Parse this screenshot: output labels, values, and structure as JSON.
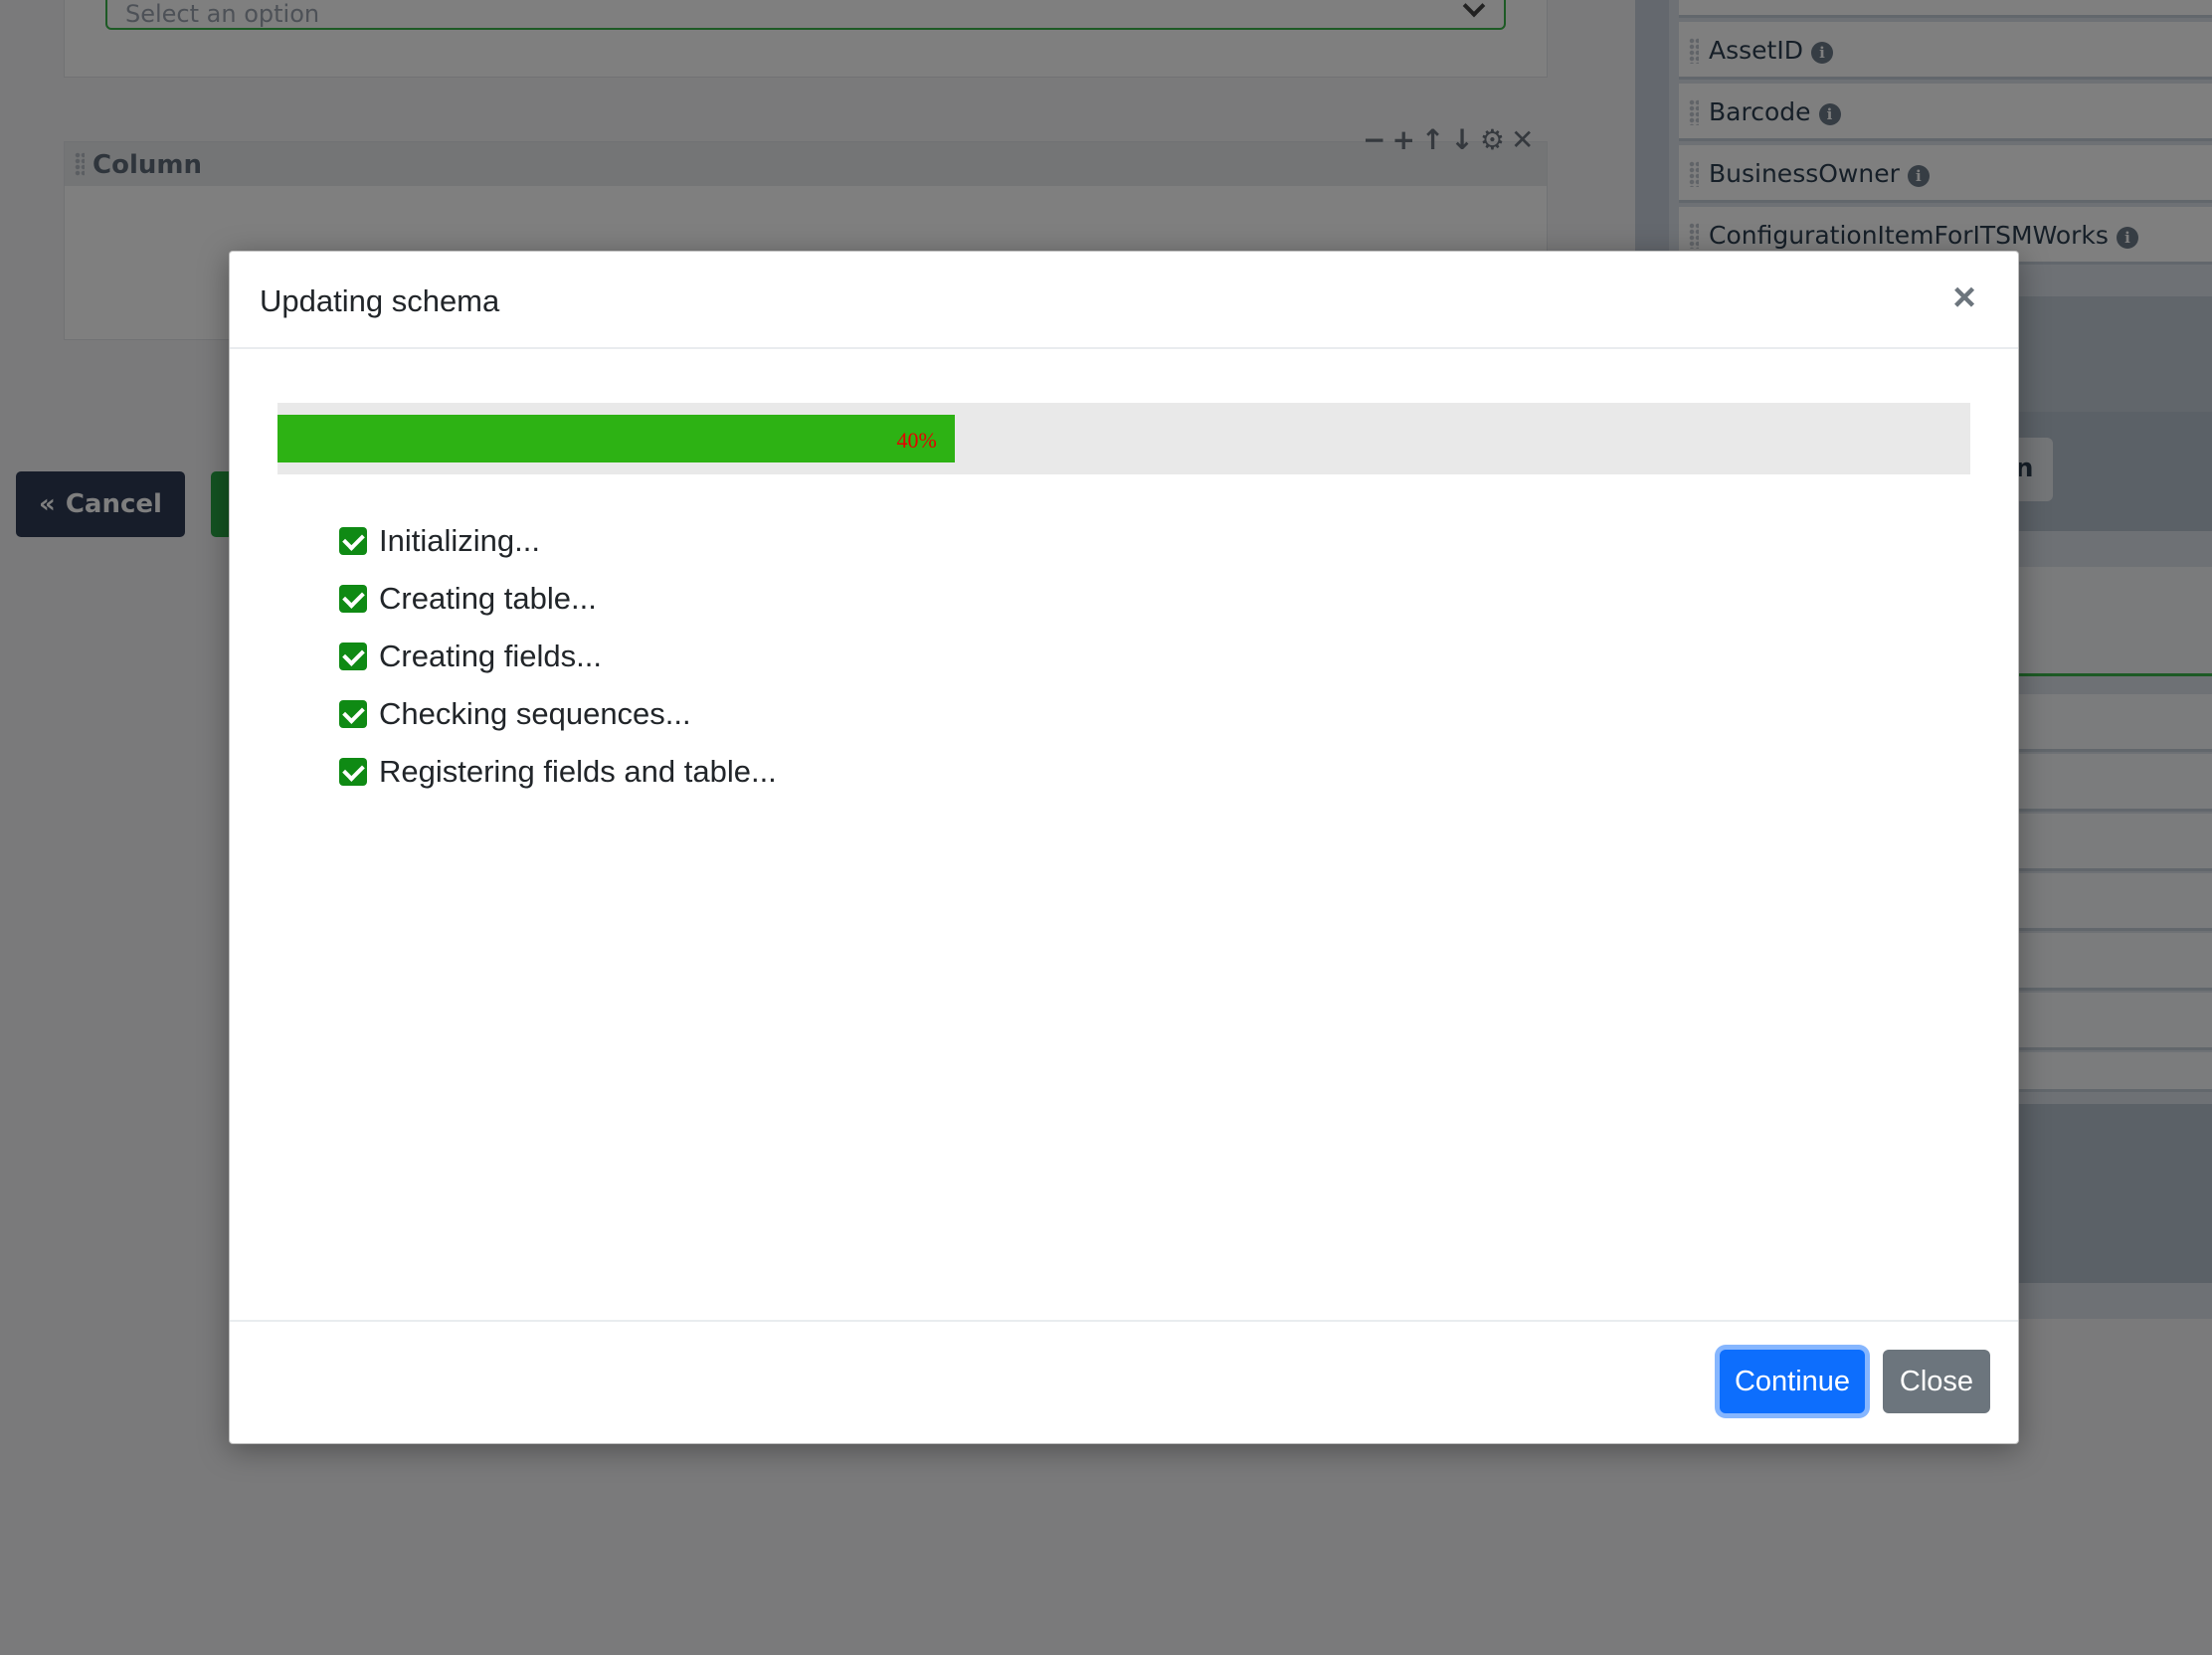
{
  "background": {
    "select": {
      "placeholder": "Select an option"
    },
    "column_card": {
      "title": "Column",
      "tools": "−+↑↓⚙✕"
    },
    "cancel_button": {
      "label": "Cancel",
      "icon": "double-chevron-left-icon"
    },
    "fields": [
      {
        "name": "AssetID"
      },
      {
        "name": "Barcode"
      },
      {
        "name": "BusinessOwner"
      },
      {
        "name": "ConfigurationItemForITSMWorks"
      }
    ],
    "right_button_partial_text": "n"
  },
  "modal": {
    "title": "Updating schema",
    "close_icon": "close-icon",
    "progress": {
      "percent": 40,
      "label": "40%",
      "fill_color": "#2db214",
      "label_color": "#e60000"
    },
    "steps": [
      {
        "label": "Initializing...",
        "checked": true
      },
      {
        "label": "Creating table...",
        "checked": true
      },
      {
        "label": "Creating fields...",
        "checked": true
      },
      {
        "label": "Checking sequences...",
        "checked": true
      },
      {
        "label": "Registering fields and table...",
        "checked": true
      }
    ],
    "footer": {
      "continue_label": "Continue",
      "close_label": "Close"
    }
  },
  "colors": {
    "primary": "#0d6efd",
    "secondary": "#6c757d",
    "success": "#0f8a14"
  }
}
